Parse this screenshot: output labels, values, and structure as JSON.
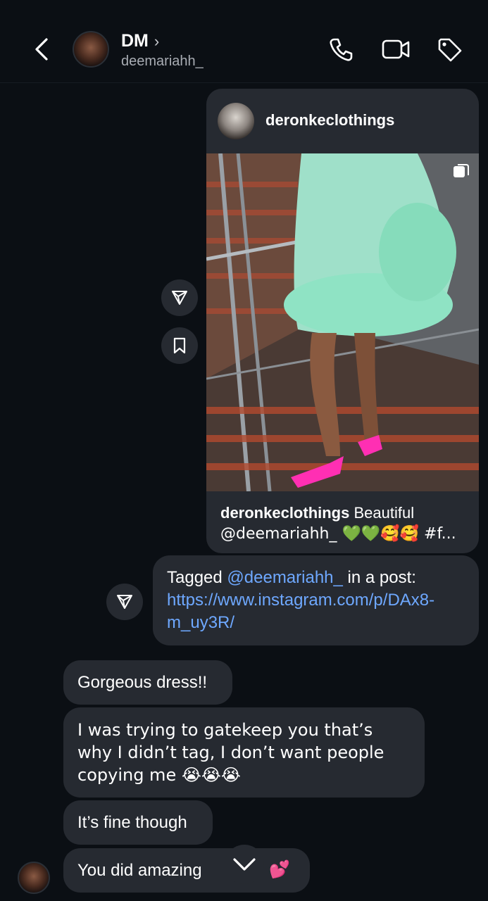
{
  "header": {
    "title": "DM",
    "chevron": "›",
    "handle": "deemariahh_",
    "icons": [
      "back-arrow-icon",
      "phone-icon",
      "video-camera-icon",
      "tag-icon"
    ]
  },
  "post": {
    "username": "deronkeclothings",
    "caption_user": "deronkeclothings",
    "caption_text": " Beautiful",
    "caption_line2": "@deemariahh_ 💚💚🥰🥰 #f...",
    "image_alt": "mint feather-trimmed dress photo"
  },
  "actions": {
    "share_icon": "send-icon",
    "save_icon": "bookmark-icon"
  },
  "messages": {
    "tagged_prefix": "Tagged ",
    "tagged_mention": "@deemariahh_",
    "tagged_suffix": " in a post:",
    "tagged_link_line1": "https://www.instagram.com/p/DAx8-",
    "tagged_link_line2": "m_uy3R/",
    "msg1": "Gorgeous dress!!",
    "msg2": "I was trying to gatekeep you that’s why I didn’t tag, I don’t want people copying me 😭😭😭",
    "msg3": "It’s fine though",
    "msg4": "You did amazing",
    "msg4_emoji": "💕"
  },
  "colors": {
    "background": "#0b0f14",
    "bubble": "#262a31",
    "link": "#6ea8ff",
    "accent_green": "#8fe3c4",
    "heels": "#ff2fb3"
  }
}
